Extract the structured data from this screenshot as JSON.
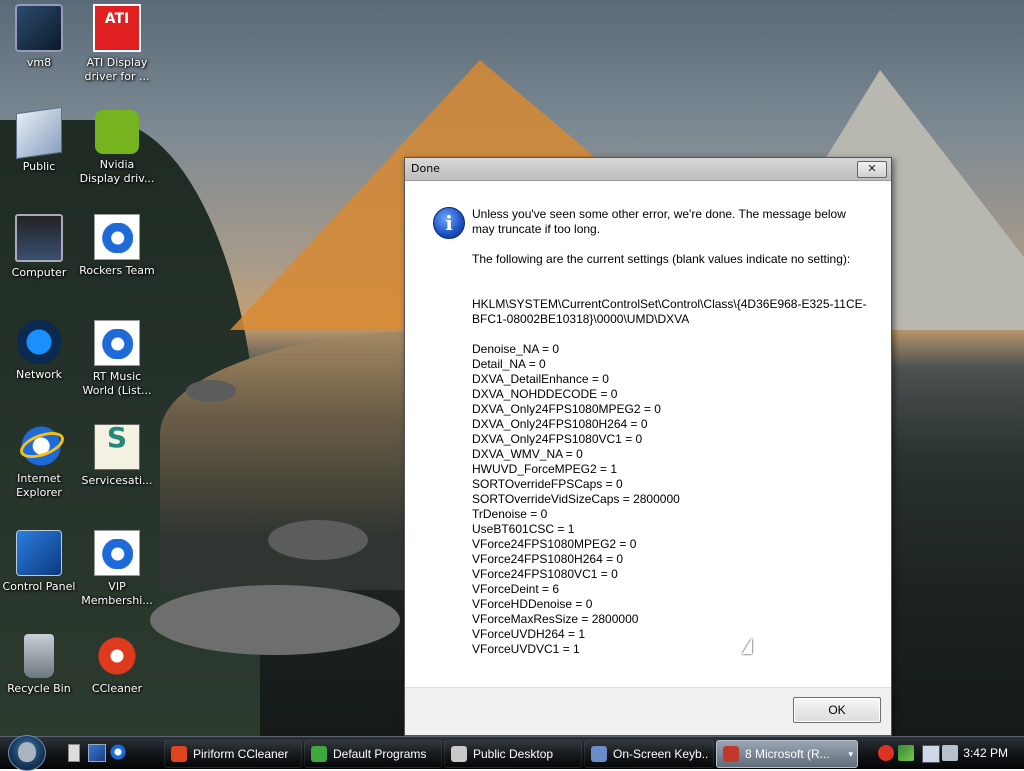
{
  "desktop": {
    "icons": [
      {
        "label": "vm8"
      },
      {
        "label": "ATI Display driver for ..."
      },
      {
        "label": "Public"
      },
      {
        "label": "Nvidia Display driv..."
      },
      {
        "label": "Computer"
      },
      {
        "label": "Rockers Team"
      },
      {
        "label": "Network"
      },
      {
        "label": "RT Music World (List..."
      },
      {
        "label": "Internet Explorer"
      },
      {
        "label": "Servicesati..."
      },
      {
        "label": "Control Panel"
      },
      {
        "label": "VIP Membershi..."
      },
      {
        "label": "Recycle Bin"
      },
      {
        "label": "CCleaner"
      }
    ],
    "ati_logo_text": "ATI"
  },
  "dialog": {
    "title": "Done",
    "close_label": "✕",
    "message_line1": "Unless you've seen some other error, we're done. The message below may truncate if too long.",
    "message_line2": "The following are the current settings (blank values indicate no setting):",
    "registry_path": "HKLM\\SYSTEM\\CurrentControlSet\\Control\\Class\\{4D36E968-E325-11CE-BFC1-08002BE10318}\\0000\\UMD\\DXVA",
    "settings": [
      "Denoise_NA = 0",
      "Detail_NA = 0",
      "DXVA_DetailEnhance = 0",
      "DXVA_NOHDDECODE = 0",
      "DXVA_Only24FPS1080MPEG2 = 0",
      "DXVA_Only24FPS1080H264 = 0",
      "DXVA_Only24FPS1080VC1 = 0",
      "DXVA_WMV_NA = 0",
      "HWUVD_ForceMPEG2 = 1",
      "SORTOverrideFPSCaps = 0",
      "SORTOverrideVidSizeCaps = 2800000",
      "TrDenoise = 0",
      "UseBT601CSC = 1",
      "VForce24FPS1080MPEG2 = 0",
      "VForce24FPS1080H264 = 0",
      "VForce24FPS1080VC1 = 0",
      "VForceDeint = 6",
      "VForceHDDenoise = 0",
      "VForceMaxResSize = 2800000",
      "VForceUVDH264 = 1",
      "VForceUVDVC1 = 1"
    ],
    "ok_label": "OK"
  },
  "taskbar": {
    "tasks": [
      {
        "label": "Piriform CCleaner",
        "color": "#e0441e"
      },
      {
        "label": "Default Programs",
        "color": "#3da83d"
      },
      {
        "label": "Public Desktop",
        "color": "#c8c8c8"
      },
      {
        "label": "On-Screen Keyb...",
        "color": "#6a8cc8"
      },
      {
        "label": "8 Microsoft (R...",
        "color": "#c0392b"
      }
    ],
    "more_glyph": "▾",
    "clock": "3:42 PM"
  }
}
